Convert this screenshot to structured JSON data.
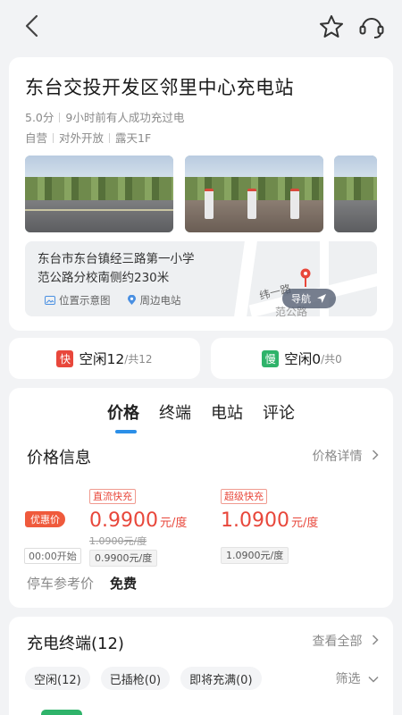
{
  "topbar": {
    "back_icon": "chevron-left-icon",
    "favorite_icon": "star-outline-icon",
    "service_icon": "headset-icon"
  },
  "station": {
    "name": "东台交投开发区邻里中心充电站",
    "rating": "5.0分",
    "recent": "9小时前有人成功充过电",
    "attr1": "自营",
    "attr2": "对外开放",
    "attr3": "露天1F",
    "address_line1": "东台市东台镇经三路第一小学",
    "address_line2": "范公路分校南侧约230米",
    "link_location": "位置示意图",
    "link_nearby": "周边电站",
    "road_label": "纬一路",
    "road_label2": "范公路",
    "nav_label": "导航"
  },
  "status": {
    "fast_tag": "快",
    "fast_text": "空闲12",
    "fast_total": "/共12",
    "slow_tag": "慢",
    "slow_text": "空闲0",
    "slow_total": "/共0",
    "fast_color": "#e8473b",
    "slow_color": "#2fb36a"
  },
  "tabs": [
    "价格",
    "终端",
    "电站",
    "评论"
  ],
  "price": {
    "section_title": "价格信息",
    "details_link": "价格详情",
    "promo_label": "优惠价",
    "start_label": "00:00开始",
    "dc_fast": {
      "tag": "直流快充",
      "value": "0.9900",
      "unit": "元/度",
      "original": "1.0900元/度",
      "base": "0.9900元/度"
    },
    "super_fast": {
      "tag": "超级快充",
      "value": "1.0900",
      "unit": "元/度",
      "base": "1.0900元/度"
    },
    "parking_label": "停车参考价",
    "parking_value": "免费"
  },
  "terminals": {
    "title": "充电终端(12)",
    "view_all": "查看全部",
    "filters": [
      "空闲(12)",
      "已插枪(0)",
      "即将充满(0)"
    ],
    "filter_btn": "筛选"
  },
  "colors": {
    "accent_red": "#e8473b",
    "accent_blue": "#2b8fe8",
    "background": "#f2f3f5"
  }
}
